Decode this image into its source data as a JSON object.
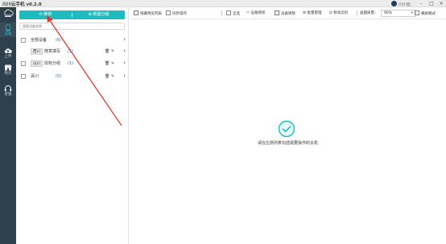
{
  "titlebar": {
    "title": "川川云手机 v0.2.0",
    "username": "川川云"
  },
  "leftnav": {
    "items": [
      {
        "label": "设备",
        "icon": "phone-icon",
        "active": true
      },
      {
        "label": "上传",
        "icon": "cloud-upload-icon",
        "active": false
      },
      {
        "label": "购买",
        "icon": "shop-icon",
        "active": false
      },
      {
        "label": "客服",
        "icon": "headset-icon",
        "active": false
      }
    ]
  },
  "sidepanel": {
    "refresh_label": "刷新",
    "new_group_label": "新建分组",
    "search_placeholder": "搜索设备名称",
    "groups": [
      {
        "name": "全部设备",
        "count": "(6)",
        "tag": "",
        "actions": false
      },
      {
        "name": "随意填写",
        "count": "(1)",
        "tag": "西川",
        "actions": true
      },
      {
        "name": "授权分组",
        "count": "(1)",
        "tag": "山川",
        "actions": true
      },
      {
        "name": "百川",
        "count": "(0)",
        "tag": "",
        "actions": true
      }
    ]
  },
  "toolbar": {
    "hide_preview": "隐藏预览列表",
    "sync_ops": "同步操作",
    "select_all": "全选",
    "device_auth": "设备授权",
    "device_renew": "设备转移",
    "batch_manage": "批量管理",
    "move_cloud": "移动云机",
    "quality_label": "画面质量：",
    "quality_value": "90%",
    "landscape": "横屏模式"
  },
  "main": {
    "empty_text": "请在左侧列表勾选需要操作的云机"
  },
  "colors": {
    "accent": "#1fbcbf",
    "nav_bg": "#2f3f4b",
    "annotation_arrow": "#e03a2f",
    "count_blue": "#1f66c9"
  }
}
